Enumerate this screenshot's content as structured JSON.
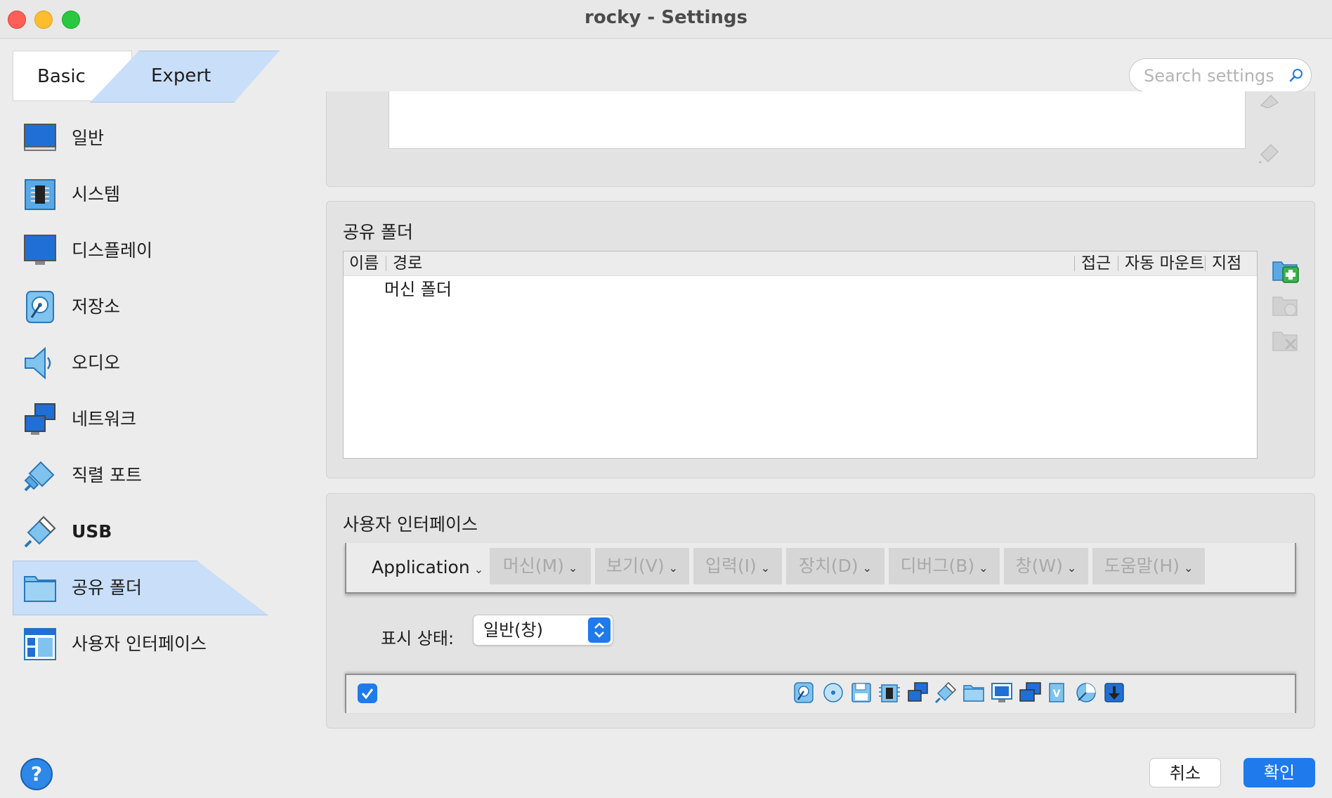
{
  "window": {
    "title": "rocky - Settings"
  },
  "mode": {
    "basic": "Basic",
    "expert": "Expert"
  },
  "search": {
    "placeholder": "Search settings"
  },
  "sidebar": {
    "items": [
      {
        "label": "일반",
        "icon": "general-icon"
      },
      {
        "label": "시스템",
        "icon": "system-icon"
      },
      {
        "label": "디스플레이",
        "icon": "display-icon"
      },
      {
        "label": "저장소",
        "icon": "storage-icon"
      },
      {
        "label": "오디오",
        "icon": "audio-icon"
      },
      {
        "label": "네트워크",
        "icon": "network-icon"
      },
      {
        "label": "직렬 포트",
        "icon": "serial-port-icon"
      },
      {
        "label": "USB",
        "icon": "usb-icon"
      },
      {
        "label": "공유 폴더",
        "icon": "shared-folder-icon",
        "selected": true
      },
      {
        "label": "사용자 인터페이스",
        "icon": "user-interface-icon"
      }
    ]
  },
  "shared_folders": {
    "title": "공유 폴더",
    "columns": {
      "name": "이름",
      "path": "경로",
      "access": "접근",
      "auto_mount": "자동 마운트",
      "mount_point": "지점"
    },
    "rows": [
      {
        "name": "머신 폴더"
      }
    ]
  },
  "user_interface": {
    "title": "사용자 인터페이스",
    "menubar": {
      "app": "Application",
      "menus": [
        "머신(M)",
        "보기(V)",
        "입력(I)",
        "장치(D)",
        "디버그(B)",
        "창(W)",
        "도움말(H)"
      ]
    },
    "display_state": {
      "label": "표시 상태:",
      "value": "일반(창)"
    },
    "statusbar": {
      "enabled": true
    }
  },
  "buttons": {
    "help": "?",
    "cancel": "취소",
    "ok": "확인"
  },
  "colors": {
    "accent": "#1f7aeb",
    "selection": "#c9def8"
  }
}
